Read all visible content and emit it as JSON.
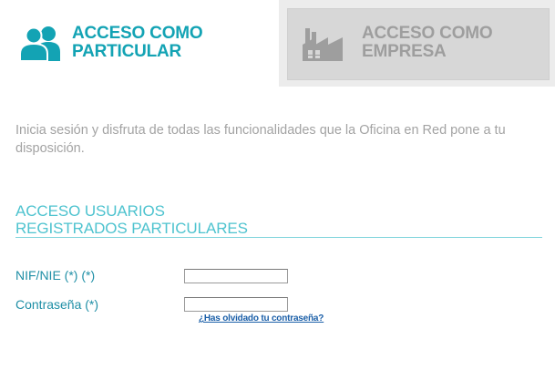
{
  "tabs": {
    "particular": {
      "line1": "ACCESO COMO",
      "line2": "PARTICULAR",
      "icon": "users-icon",
      "color": "#13a3b4",
      "active": true
    },
    "empresa": {
      "line1": "ACCESO COMO",
      "line2": "EMPRESA",
      "icon": "factory-icon",
      "color": "#9e9e9e",
      "active": false
    }
  },
  "intro_text": "Inicia sesión y disfruta de todas las funcionalidades que la Oficina en Red pone a tu disposición.",
  "section": {
    "title_line1": "ACCESO USUARIOS",
    "title_line2": "REGISTRADOS PARTICULARES"
  },
  "form": {
    "nif_label": "NIF/NIE (*) (*)",
    "nif_value": "",
    "password_label": "Contraseña (*)",
    "password_value": "",
    "forgot_link": "¿Has olvidado tu contraseña?"
  },
  "colors": {
    "accent": "#13a3b4",
    "label": "#1f8fa6",
    "muted": "#a3a3a3",
    "link": "#1b5fa8"
  }
}
